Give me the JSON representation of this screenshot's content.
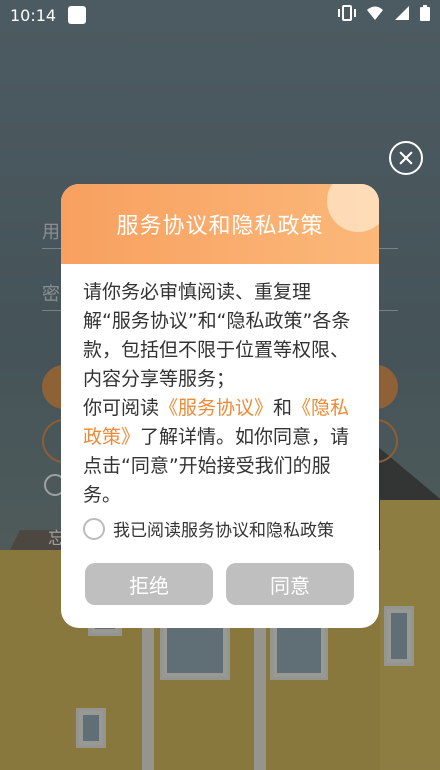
{
  "status_bar": {
    "time": "10:14",
    "icons": [
      "vibrate-icon",
      "wifi-icon",
      "signal-icon",
      "battery-icon"
    ]
  },
  "background_form": {
    "username_hint": "用",
    "password_hint": "密",
    "forgot_hint": "忘",
    "chevron": "›"
  },
  "dialog": {
    "title": "服务协议和隐私政策",
    "body_intro": "请你务必审慎阅读、重复理解“服务协议”和“隐私政策”各条款，包括但不限于位置等权限、内容分享等服务；",
    "body_read_prefix": "你可阅读",
    "service_link": "《服务协议》",
    "and_text": "和",
    "privacy_link": "《隐私政策》",
    "body_read_suffix": "了解详情。如你同意，请点击“同意”开始接受我们的服务。",
    "agree_label": "我已阅读服务协议和隐私政策",
    "reject_label": "拒绝",
    "accept_label": "同意"
  },
  "colors": {
    "accent_orange": "#f8a060",
    "link_orange": "#ee8a35",
    "button_gray": "#bfbfbf"
  }
}
